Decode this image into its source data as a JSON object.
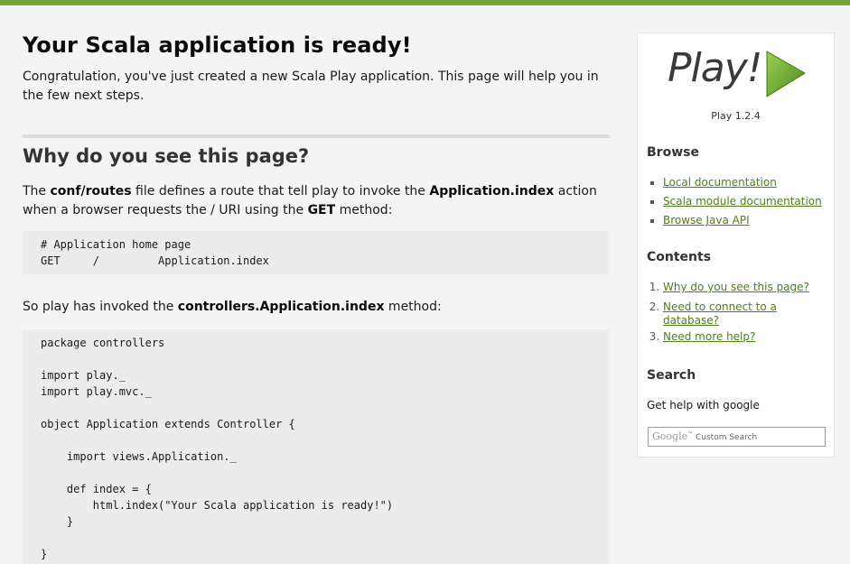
{
  "main": {
    "title": "Your Scala application is ready!",
    "intro": "Congratulation, you've just created a new Scala Play application. This page will help you in the few next steps.",
    "section_title": "Why do you see this page?",
    "p1": {
      "a": "The ",
      "b": "conf/routes",
      "c": " file defines a route that tell play to invoke the ",
      "d": "Application.index",
      "e": " action when a browser requests the / URI using the ",
      "f": "GET",
      "g": " method:"
    },
    "code1": "# Application home page\nGET     /         Application.index",
    "p2": {
      "a": "So play has invoked the ",
      "b": "controllers.Application.index",
      "c": " method:"
    },
    "code2": "package controllers\n\nimport play._\nimport play.mvc._\n\nobject Application extends Controller {\n\n    import views.Application._\n\n    def index = {\n        html.index(\"Your Scala application is ready!\")\n    }\n\n}"
  },
  "sidebar": {
    "logo_text": "Play!",
    "version": "Play 1.2.4",
    "browse_title": "Browse",
    "browse_links": [
      "Local documentation",
      "Scala module documentation",
      "Browse Java API"
    ],
    "contents_title": "Contents",
    "contents_links": [
      "Why do you see this page?",
      "Need to connect to a database?",
      "Need more help?"
    ],
    "search_title": "Search",
    "search_help": "Get help with google",
    "search_google": "Google",
    "search_placeholder": "Custom Search"
  },
  "colors": {
    "accent": "#75a53a",
    "link": "#4f7d1d"
  }
}
